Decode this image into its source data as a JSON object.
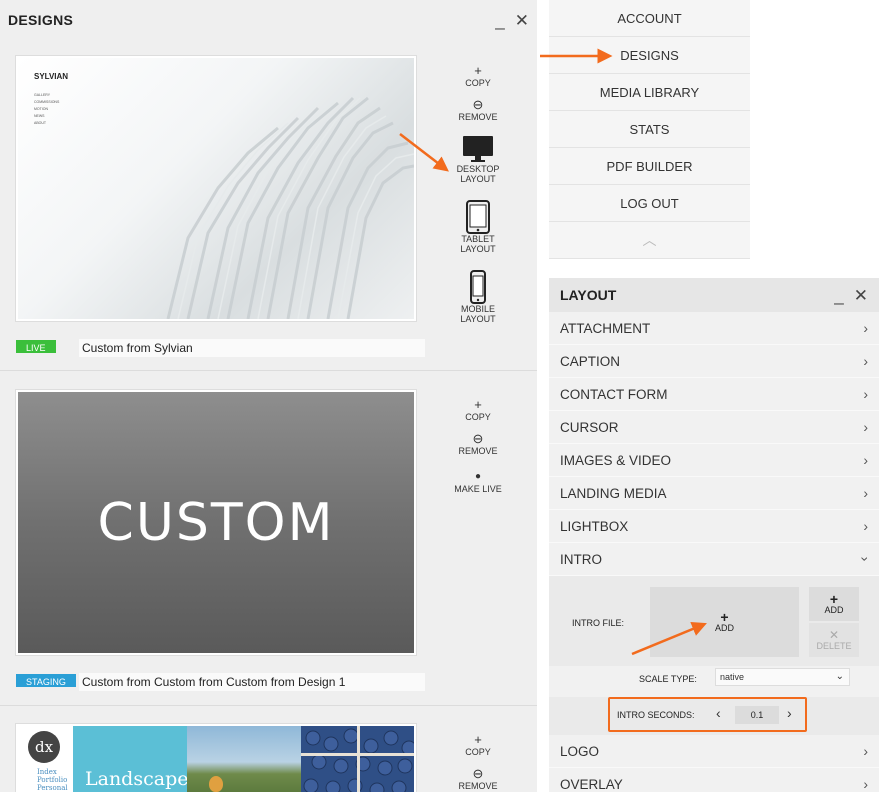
{
  "designs_panel": {
    "title": "DESIGNS",
    "minimize": "_",
    "close": "✕",
    "cards": [
      {
        "thumb_brand": "SYLVIAN",
        "thumb_menu": [
          "GALLERY",
          "COMMISSIONS",
          "MOTION",
          "NEWS",
          "ABOUT"
        ],
        "actions": [
          {
            "icon": "+",
            "label": "COPY"
          },
          {
            "icon": "⊖",
            "label": "REMOVE"
          },
          {
            "icon": "desktop",
            "label": "DESKTOP LAYOUT"
          },
          {
            "icon": "tablet",
            "label": "TABLET LAYOUT"
          },
          {
            "icon": "mobile",
            "label": "MOBILE LAYOUT"
          }
        ],
        "status": "LIVE",
        "status_color": "#3bbf3b",
        "name": "Custom from Sylvian"
      },
      {
        "thumb_text": "CUSTOM",
        "actions": [
          {
            "icon": "+",
            "label": "COPY"
          },
          {
            "icon": "⊖",
            "label": "REMOVE"
          },
          {
            "icon": "●",
            "label": "MAKE LIVE"
          }
        ],
        "status": "STAGING",
        "status_color": "#2a9fd6",
        "name": "Custom from Custom from Custom from Design 1"
      },
      {
        "thumb_logo": "dx",
        "thumb_menu": [
          "Index",
          "Portfolio",
          "Personal"
        ],
        "thumb_caption": "Landscape",
        "actions": [
          {
            "icon": "+",
            "label": "COPY"
          },
          {
            "icon": "⊖",
            "label": "REMOVE"
          }
        ]
      }
    ]
  },
  "account_menu": {
    "items": [
      "ACCOUNT",
      "DESIGNS",
      "MEDIA LIBRARY",
      "STATS",
      "PDF BUILDER",
      "LOG OUT"
    ],
    "collapse_icon": "︿"
  },
  "layout_panel": {
    "title": "LAYOUT",
    "minimize": "_",
    "close": "✕",
    "sections": [
      "ATTACHMENT",
      "CAPTION",
      "CONTACT FORM",
      "CURSOR",
      "IMAGES & VIDEO",
      "LANDING MEDIA",
      "LIGHTBOX"
    ],
    "intro": {
      "label": "INTRO",
      "file_label": "INTRO FILE:",
      "drop_add": "ADD",
      "add_label": "ADD",
      "delete_label": "DELETE",
      "scale_label": "SCALE TYPE:",
      "scale_value": "native",
      "seconds_label": "INTRO SECONDS:",
      "seconds_value": "0.1"
    },
    "after_sections": [
      "LOGO",
      "OVERLAY"
    ]
  },
  "colors": {
    "accent_orange": "#f26b1d",
    "live_green": "#3bbf3b",
    "staging_blue": "#2a9fd6"
  }
}
